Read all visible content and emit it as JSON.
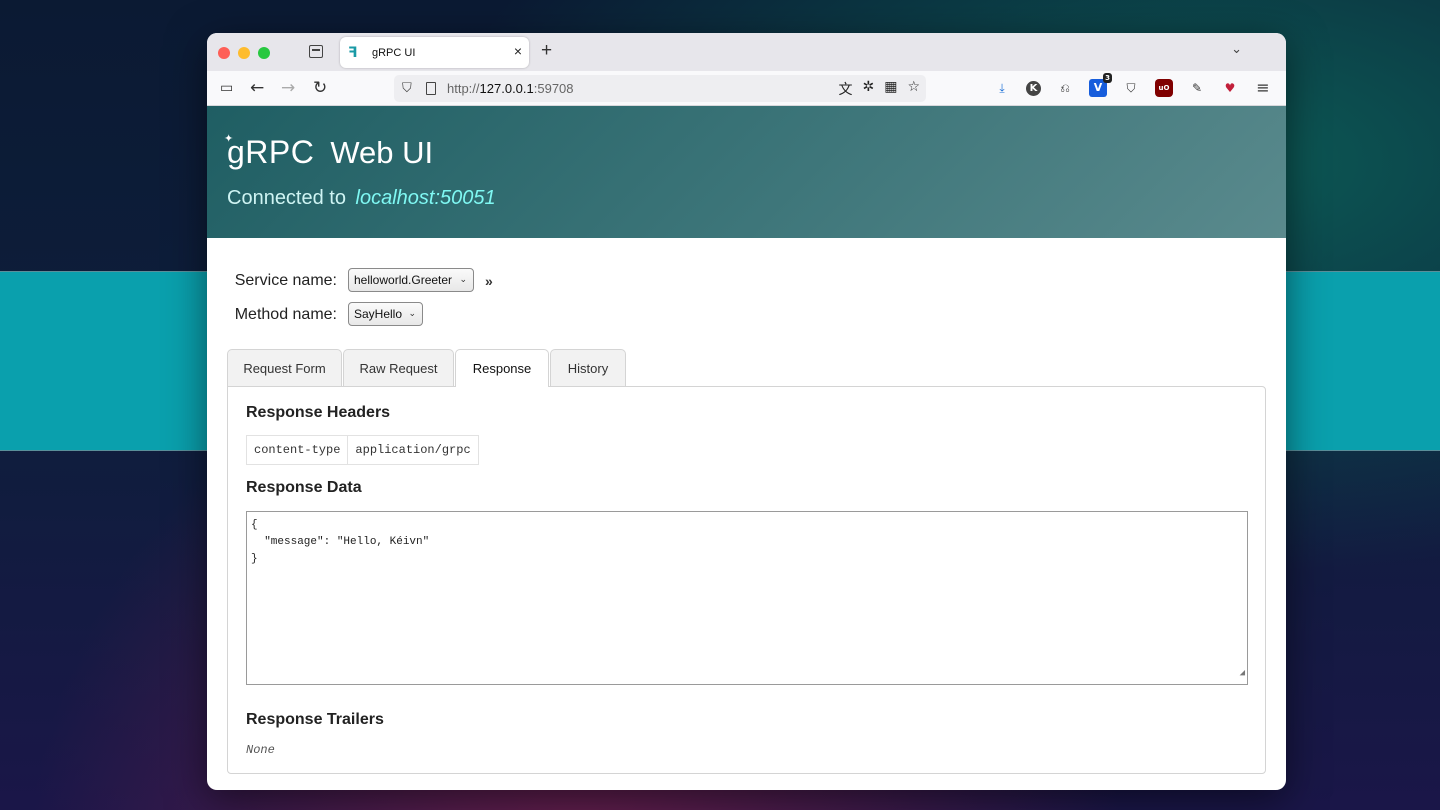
{
  "browser": {
    "tab_title": "gRPC UI",
    "tab_close": "×",
    "new_tab": "+",
    "tab_list": "⌄",
    "back": "←",
    "forward": "→",
    "reload": "↻",
    "url_scheme": "http://",
    "url_host": "127.0.0.1",
    "url_port": ":59708",
    "url_icons": [
      "translate-icon",
      "bug-icon",
      "qr-icon",
      "star-icon"
    ],
    "extensions": [
      {
        "name": "download-icon",
        "glyph": "⤓"
      },
      {
        "name": "k-extension-icon",
        "glyph": "K"
      },
      {
        "name": "puzzle-icon",
        "glyph": "⎌"
      },
      {
        "name": "bitwarden-icon",
        "glyph": "V",
        "badge": "3"
      },
      {
        "name": "shield-check-icon",
        "glyph": "⛉"
      },
      {
        "name": "ublock-icon",
        "glyph": "uO"
      },
      {
        "name": "pen-icon",
        "glyph": "✎"
      },
      {
        "name": "heart-ext-icon",
        "glyph": "♥"
      },
      {
        "name": "menu-icon",
        "glyph": "≡"
      }
    ]
  },
  "header": {
    "logo_text": "gRPC",
    "title": "Web UI",
    "connected_label": "Connected to",
    "host": "localhost:50051"
  },
  "form": {
    "service_label": "Service name:",
    "service_value": "helloworld.Greeter",
    "method_label": "Method name:",
    "method_value": "SayHello",
    "expand_label": "»"
  },
  "tabs": [
    {
      "label": "Request Form",
      "active": false
    },
    {
      "label": "Raw Request",
      "active": false
    },
    {
      "label": "Response",
      "active": true
    },
    {
      "label": "History",
      "active": false
    }
  ],
  "response": {
    "headers_title": "Response Headers",
    "headers": [
      {
        "key": "content-type",
        "value": "application/grpc"
      }
    ],
    "data_title": "Response Data",
    "data_text": "{\n  \"message\": \"Hello, Kéivn\"\n}",
    "trailers_title": "Response Trailers",
    "trailers_value": "None"
  }
}
